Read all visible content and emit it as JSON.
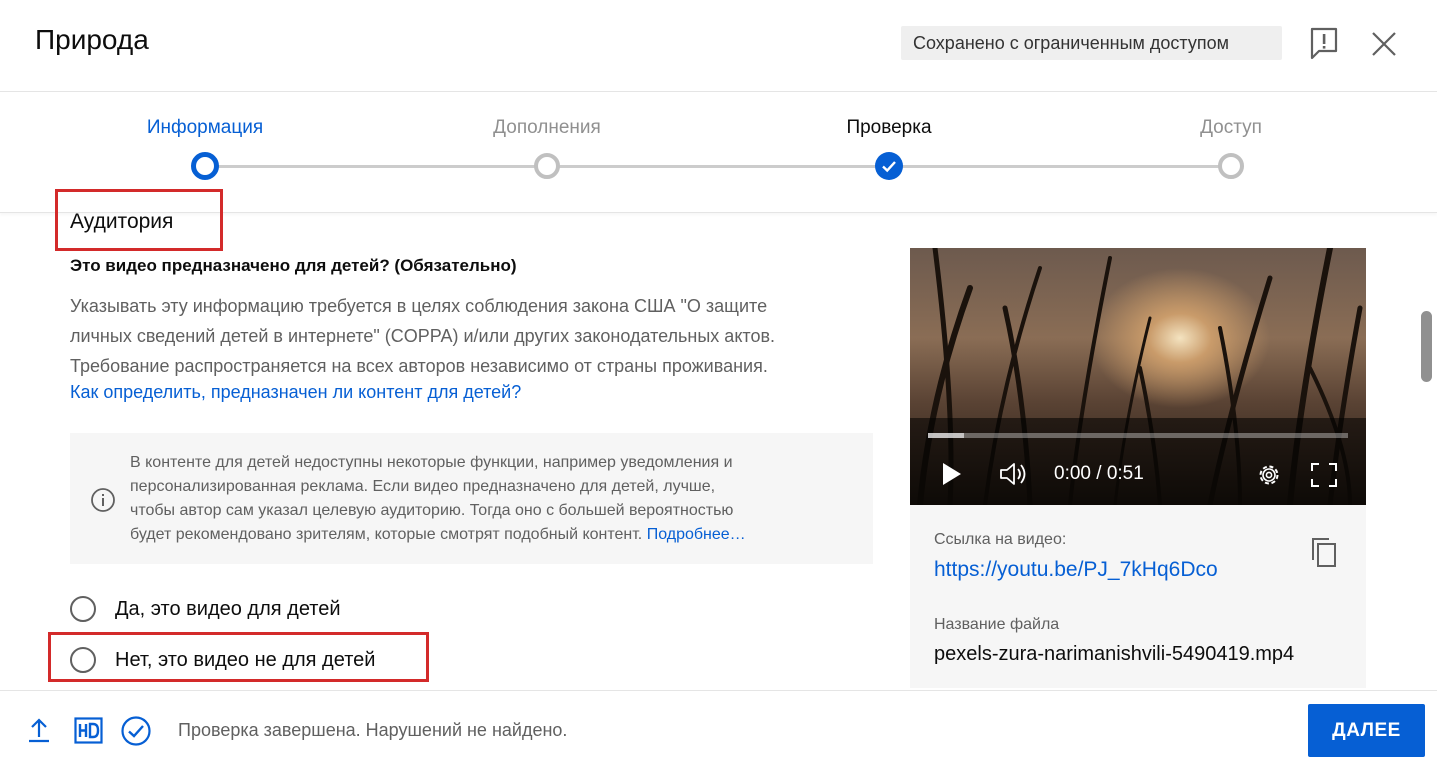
{
  "header": {
    "title": "Природа",
    "saved_status": "Сохранено с ограниченным доступом"
  },
  "stepper": {
    "steps": [
      {
        "label": "Информация",
        "state": "current"
      },
      {
        "label": "Дополнения",
        "state": "pending"
      },
      {
        "label": "Проверка",
        "state": "done"
      },
      {
        "label": "Доступ",
        "state": "pending"
      }
    ]
  },
  "audience": {
    "title": "Аудитория",
    "question": "Это видео предназначено для детей? (Обязательно)",
    "description_lines": [
      "Указывать эту информацию требуется в целях соблюдения закона США \"О защите",
      "личных сведений детей в интернете\" (COPPA) и/или других законодательных актов.",
      "Требование распространяется на всех авторов независимо от страны проживания."
    ],
    "help_link": "Как определить, предназначен ли контент для детей?",
    "info_lines": [
      "В контенте для детей недоступны некоторые функции, например уведомления и",
      "персонализированная реклама. Если видео предназначено для детей, лучше,",
      "чтобы автор сам указал целевую аудиторию. Тогда оно с большей вероятностью",
      "будет рекомендовано зрителям, которые смотрят подобный контент."
    ],
    "info_more_link": "Подробнее…",
    "options": [
      {
        "label": "Да, это видео для детей",
        "selected": false
      },
      {
        "label": "Нет, это видео не для детей",
        "selected": false
      }
    ]
  },
  "video_panel": {
    "time": "0:00 / 0:51",
    "link_label": "Ссылка на видео:",
    "link": "https://youtu.be/PJ_7kHq6Dco",
    "file_label": "Название файла",
    "file_name": "pexels-zura-narimanishvili-5490419.mp4"
  },
  "footer": {
    "status": "Проверка завершена. Нарушений не найдено.",
    "next_label": "ДАЛЕЕ"
  },
  "colors": {
    "accent": "#065fd4",
    "highlight": "#d32a2a",
    "secondary_text": "#606060"
  },
  "icons": [
    "feedback-icon",
    "close-icon",
    "info-icon",
    "play-icon",
    "volume-icon",
    "settings-icon",
    "fullscreen-icon",
    "copy-icon",
    "upload-icon",
    "hd-icon",
    "check-circle-icon"
  ]
}
